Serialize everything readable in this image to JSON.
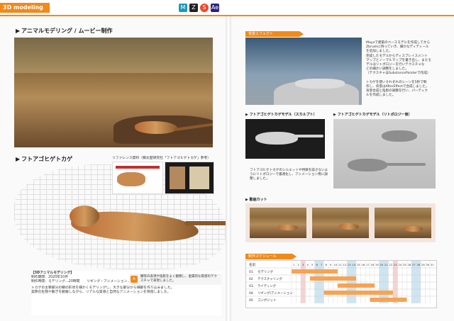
{
  "header": {
    "tab_label": "3D modeling",
    "tool_icons": [
      {
        "name": "maya-icon",
        "glyph": "M",
        "color": "#1a9bb5"
      },
      {
        "name": "zbrush-icon",
        "glyph": "Z",
        "color": "#222222"
      },
      {
        "name": "substance-icon",
        "glyph": "S",
        "color": "#e84a2b"
      },
      {
        "name": "aftereffects-icon",
        "glyph": "Ae",
        "color": "#2b2380"
      }
    ],
    "accent_color": "#f08a1a"
  },
  "left": {
    "section1_title": "アニマルモデリング / ムービー制作",
    "section2_title": "フトアゴヒゲトカゲ",
    "reference_label": "リファレンス資料（鱗太歴研究社「フトアゴヒゲトカゲ」参考）",
    "info": {
      "title": "【3Dアニマルモデリング】",
      "lines": [
        "制作期間：2020年10月",
        "制作時間：モデリング…20時間　　リギング・アニメーション…17時間",
        "トカゲの主要部分の鱗の形状を細かくモデリングし、大きな部分から細部を作り込みました。",
        "実際の生態や動きを観察しながら、リアルな質感と自然なアニメーションを目指しました。"
      ],
      "note_tag": "A",
      "note_text": "鱗等の表現や陰影をよく観察し、金属的な質感のテクスチャで表現しました。"
    }
  },
  "right": {
    "still_label": "背景エフェクト",
    "still_text": [
      "Mayaで建築のベースモデルを作成してから",
      "Zbrushに持っていき、細かなディティール",
      "を追加しました。",
      "完成したモデルからディスプレイスメント",
      "マップとノーマルマップを書き出し、またモ",
      "デルはリトポロジーを行いテクスチャな",
      "どの細かい調整をしました。",
      "（テクスチャはSubstancePainterで作成）",
      "",
      "トカゲを使いそれぞれのシーンを5秒で制",
      "作し、背景はAfterEffectで合成しました。",
      "背景合成と陰影の調整を行い、パーティク",
      "ルを作成しました。"
    ],
    "model_label_1": "フトアゴヒゲトカゲモデル（スカルプト）",
    "model_label_2": "フトアゴヒゲトカゲモデル（リトポロジー後）",
    "model_caption": "フトアゴヒゲトカゲのシルエットや特徴を崩さないようにリトポロジーで最適化し、アニメーション用に調整しました。",
    "movie_label": "動画カット",
    "schedule_label": "制作スケジュール"
  },
  "schedule": {
    "header_id": "名前",
    "days": [
      "1",
      "2",
      "3",
      "4",
      "5",
      "6",
      "7",
      "8",
      "9",
      "10",
      "11",
      "12",
      "13",
      "14",
      "15",
      "16",
      "17",
      "18",
      "19",
      "20",
      "21",
      "22",
      "23",
      "24",
      "25",
      "26",
      "27",
      "28",
      "29",
      "30",
      "31"
    ],
    "tasks": [
      {
        "id": "01",
        "name": "モデリング",
        "start": 1,
        "end": 10
      },
      {
        "id": "02",
        "name": "テクスチャリング",
        "start": 5,
        "end": 14
      },
      {
        "id": "03",
        "name": "ライティング",
        "start": 11,
        "end": 18
      },
      {
        "id": "04",
        "name": "リギング/アニメーション",
        "start": 8,
        "end": 22
      },
      {
        "id": "05",
        "name": "コンポジット",
        "start": 18,
        "end": 25
      }
    ],
    "bar_color": "#f6a453",
    "weekend_color": "#cfe5f2",
    "holiday_color": "#f6d3d3"
  }
}
